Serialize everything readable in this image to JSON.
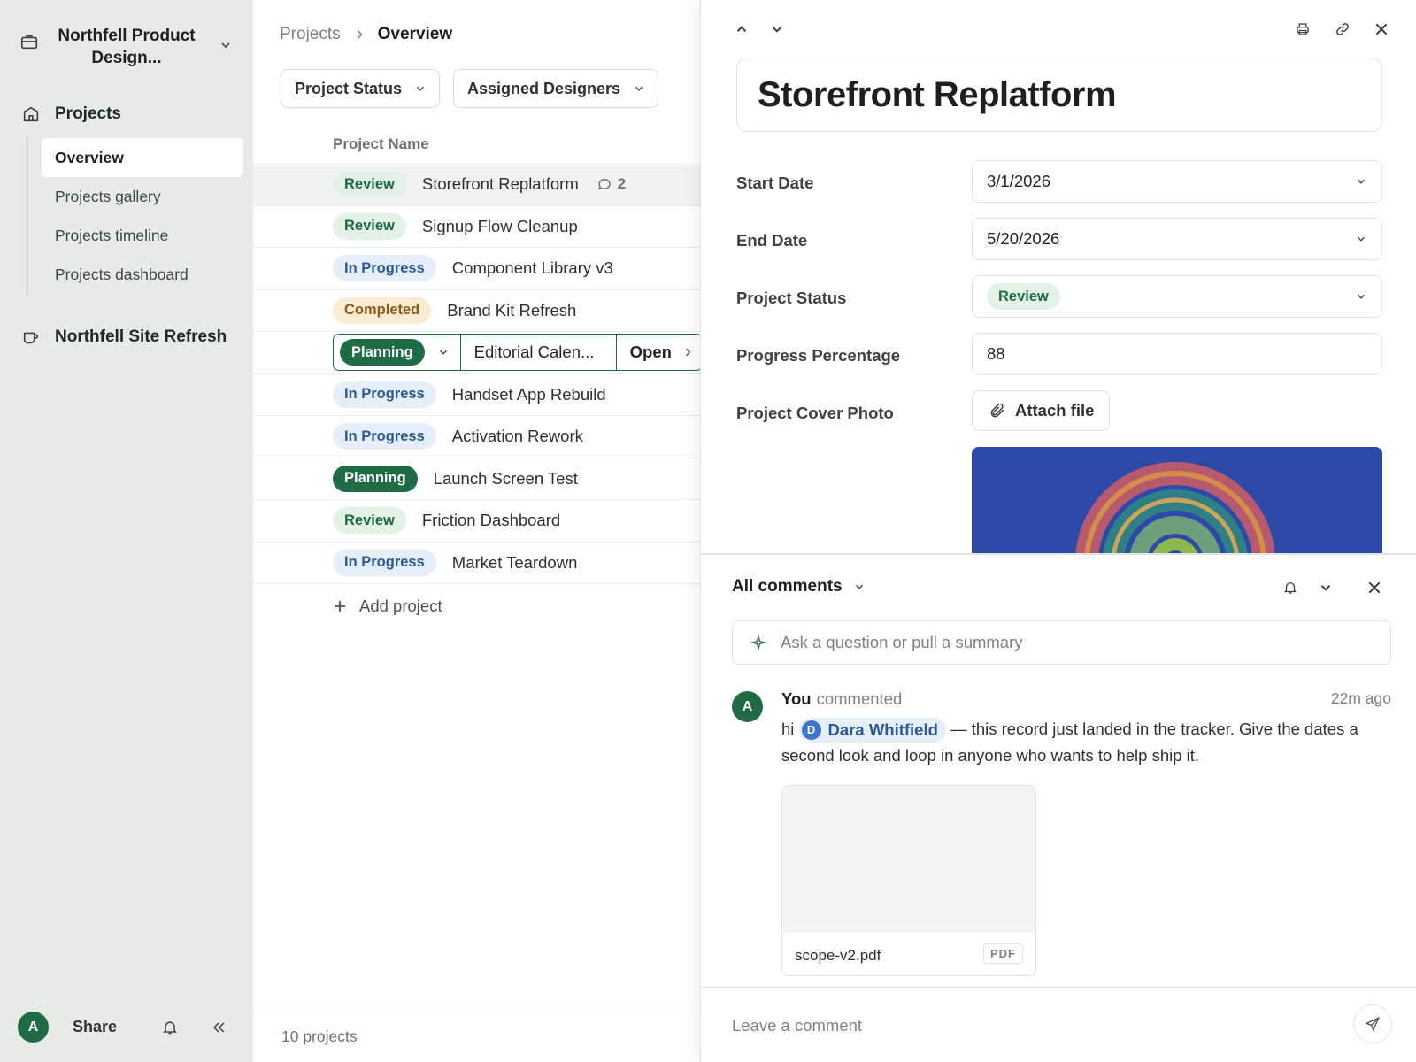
{
  "workspace": {
    "name": "Northfell Product Design...",
    "icon": "briefcase-icon"
  },
  "sidebar": {
    "groups": [
      {
        "label": "Projects",
        "icon": "building-icon"
      },
      {
        "label": "Northfell Site Refresh",
        "icon": "mug-icon"
      }
    ],
    "items": [
      {
        "label": "Overview",
        "active": true
      },
      {
        "label": "Projects gallery"
      },
      {
        "label": "Projects timeline"
      },
      {
        "label": "Projects dashboard"
      }
    ],
    "footer": {
      "avatar": "A",
      "share_label": "Share"
    }
  },
  "main": {
    "breadcrumb": [
      "Projects",
      "Overview"
    ],
    "filters": [
      "Project Status",
      "Assigned Designers"
    ],
    "column_header": "Project Name",
    "rows": [
      {
        "status": "Review",
        "name": "Storefront Replatform",
        "comments": "2"
      },
      {
        "status": "Review",
        "name": "Signup Flow Cleanup"
      },
      {
        "status": "In Progress",
        "name": "Component Library v3"
      },
      {
        "status": "Completed",
        "name": "Brand Kit Refresh"
      },
      {
        "status": "Planning",
        "name": "Editorial Calen...",
        "open_label": "Open"
      },
      {
        "status": "In Progress",
        "name": "Handset App Rebuild"
      },
      {
        "status": "In Progress",
        "name": "Activation Rework"
      },
      {
        "status": "Planning",
        "name": "Launch Screen Test"
      },
      {
        "status": "Review",
        "name": "Friction Dashboard"
      },
      {
        "status": "In Progress",
        "name": "Market Teardown"
      }
    ],
    "add_label": "Add project",
    "footer_count": "10 projects"
  },
  "record": {
    "title": "Storefront Replatform",
    "fields": {
      "start_date": {
        "label": "Start Date",
        "value": "3/1/2026"
      },
      "end_date": {
        "label": "End Date",
        "value": "5/20/2026"
      },
      "status": {
        "label": "Project Status",
        "value": "Review"
      },
      "progress": {
        "label": "Progress Percentage",
        "value": "88"
      },
      "cover": {
        "label": "Project Cover Photo",
        "button": "Attach file"
      }
    }
  },
  "comments": {
    "filter_label": "All comments",
    "ask_placeholder": "Ask a question or pull a summary",
    "items": [
      {
        "avatar": "A",
        "author": "You",
        "verb": "commented",
        "time": "22m ago",
        "prefix": "hi",
        "mention": {
          "initial": "D",
          "name": "Dara Whitfield"
        },
        "text": "— this record just landed in the tracker. Give the dates a second look and loop in anyone who wants to help ship it.",
        "attachment": {
          "name": "scope-v2.pdf",
          "type": "PDF"
        }
      }
    ],
    "composer_placeholder": "Leave a comment"
  },
  "colors": {
    "accent": "#1f6b45",
    "sidebar_bg": "#e6ebe6",
    "review_bg": "#e3f1e7",
    "progress_bg": "#e6eef9",
    "completed_bg": "#fbecd3"
  }
}
